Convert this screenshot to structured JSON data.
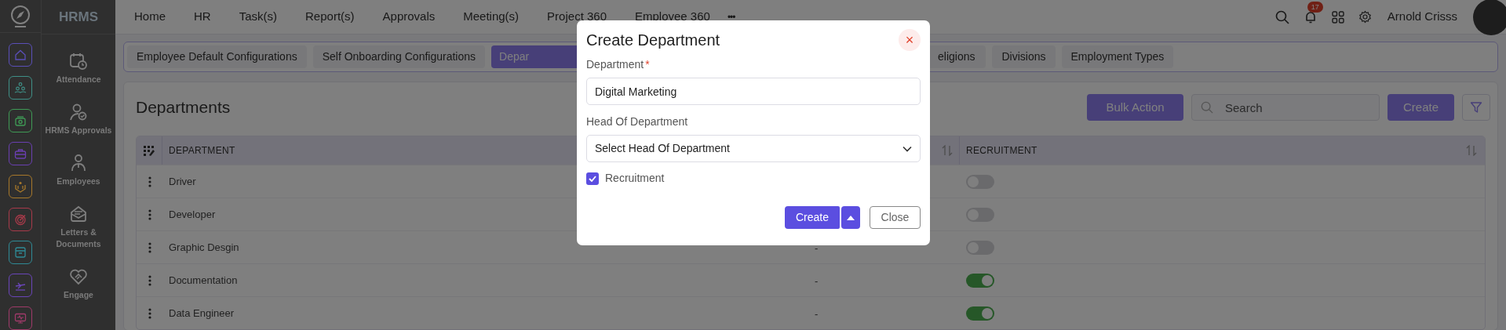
{
  "logo": {
    "title": "HRMS"
  },
  "app_rail": [
    {
      "color": "#5a4fb8"
    },
    {
      "color": "#3f8f86"
    },
    {
      "color": "#3f9a55"
    },
    {
      "color": "#6a3fb0"
    },
    {
      "color": "#a7782a"
    },
    {
      "color": "#a83a4a"
    },
    {
      "color": "#2f8a96"
    },
    {
      "color": "#6a45b8"
    },
    {
      "color": "#a03a6a"
    }
  ],
  "sidebar": {
    "items": [
      {
        "label": "Attendance"
      },
      {
        "label": "HRMS Approvals"
      },
      {
        "label": "Employees"
      },
      {
        "label": "Letters & Documents"
      },
      {
        "label": "Engage"
      }
    ]
  },
  "top_nav": {
    "items": [
      "Home",
      "HR",
      "Task(s)",
      "Report(s)",
      "Approvals",
      "Meeting(s)",
      "Project 360",
      "Employee 360"
    ],
    "more": "•••"
  },
  "header": {
    "notification_count": "17",
    "user_name": "Arnold Crisss"
  },
  "config_tabs": [
    {
      "label": "Employee Default Configurations",
      "selected": false
    },
    {
      "label": "Self Onboarding Configurations",
      "selected": false
    },
    {
      "label": "Depar",
      "selected": true
    },
    {
      "label": "eligions",
      "selected": false
    },
    {
      "label": "Divisions",
      "selected": false
    },
    {
      "label": "Employment Types",
      "selected": false
    }
  ],
  "page": {
    "title": "Departments",
    "bulk_action": "Bulk Action",
    "search_placeholder": "Search",
    "create": "Create"
  },
  "table": {
    "columns": [
      {
        "label": "DEPARTMENT"
      },
      {
        "label": "RECRUITMENT"
      }
    ],
    "rows": [
      {
        "department": "Driver",
        "recruitment": false
      },
      {
        "department": "Developer",
        "recruitment": false
      },
      {
        "department": "Graphic Desgin",
        "column_2": "-",
        "recruitment": false
      },
      {
        "department": "Documentation",
        "column_2": "-",
        "recruitment": true
      },
      {
        "department": "Data Engineer",
        "column_2": "-",
        "recruitment": true
      }
    ]
  },
  "dialog": {
    "title": "Create Department",
    "close": "×",
    "department": {
      "label": "Department",
      "required_mark": "*",
      "value": "Digital Marketing"
    },
    "head": {
      "label": "Head Of Department",
      "value": "Select Head Of Department"
    },
    "recruitment": {
      "label": "Recruitment",
      "checked": true
    },
    "buttons": {
      "create": "Create",
      "close": "Close"
    }
  }
}
